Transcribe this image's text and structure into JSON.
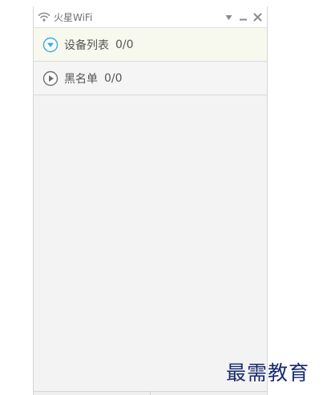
{
  "window": {
    "title": "火星WiFi",
    "icons": {
      "app": "wifi-icon",
      "dropdown": "triangle-down-icon",
      "minimize": "minimize-icon",
      "close": "close-icon"
    }
  },
  "sections": [
    {
      "label": "设备列表",
      "count": "0/0",
      "state": "expanded",
      "icon": "circle-chevron-down-icon"
    },
    {
      "label": "黑名单",
      "count": "0/0",
      "state": "collapsed",
      "icon": "circle-play-icon"
    }
  ],
  "watermark": "最需教育",
  "colors": {
    "accent": "#3fa8e0",
    "muted": "#8a8a8a"
  }
}
